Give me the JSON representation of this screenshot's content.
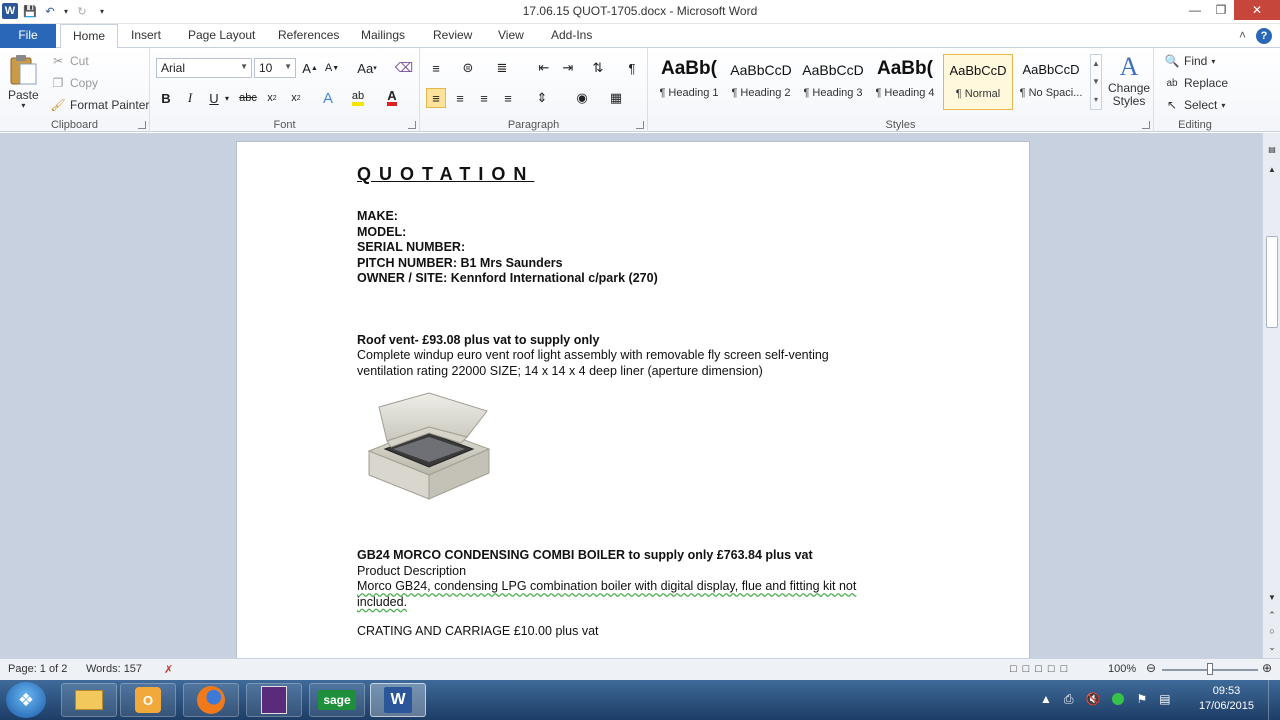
{
  "window": {
    "title": "17.06.15 QUOT-1705.docx - Microsoft Word",
    "app_icon": "word-icon"
  },
  "tabs": [
    {
      "label": "File",
      "key": "file"
    },
    {
      "label": "Home",
      "key": "home",
      "active": true
    },
    {
      "label": "Insert",
      "key": "insert"
    },
    {
      "label": "Page Layout",
      "key": "page-layout"
    },
    {
      "label": "References",
      "key": "references"
    },
    {
      "label": "Mailings",
      "key": "mailings"
    },
    {
      "label": "Review",
      "key": "review"
    },
    {
      "label": "View",
      "key": "view"
    },
    {
      "label": "Add-Ins",
      "key": "add-ins"
    }
  ],
  "ribbon": {
    "clipboard": {
      "label": "Clipboard",
      "paste": "Paste",
      "cut": "Cut",
      "copy": "Copy",
      "format_painter": "Format Painter"
    },
    "font": {
      "label": "Font",
      "font_name": "Arial",
      "font_size": "10"
    },
    "paragraph": {
      "label": "Paragraph"
    },
    "styles": {
      "label": "Styles",
      "items": [
        {
          "sample": "AaBb(",
          "name": "¶ Heading 1"
        },
        {
          "sample": "AaBbCcD",
          "name": "¶ Heading 2"
        },
        {
          "sample": "AaBbCcD",
          "name": "¶ Heading 3"
        },
        {
          "sample": "AaBb(",
          "name": "¶ Heading 4"
        },
        {
          "sample": "AaBbCcD",
          "name": "¶ Normal",
          "selected": true
        },
        {
          "sample": "AaBbCcD",
          "name": "¶ No Spaci..."
        }
      ],
      "change_styles": "Change",
      "change_styles_2": "Styles"
    },
    "editing": {
      "label": "Editing",
      "find": "Find",
      "replace": "Replace",
      "select": "Select"
    }
  },
  "document": {
    "title": "QUOTATION",
    "make": "MAKE:",
    "model": "MODEL:",
    "serial": "SERIAL  NUMBER:",
    "pitch": "PITCH NUMBER: B1 Mrs Saunders",
    "owner": "OWNER / SITE: Kennford  International  c/park (270)",
    "item1_heading": "Roof vent- £93.08 plus vat to supply only",
    "item1_line1": "Complete windup euro vent roof light assembly with removable fly screen self-venting",
    "item1_line2": "ventilation rating 22000  SIZE;  14 x 14 x 4 deep liner (aperture  dimension)",
    "item2_heading": "GB24  MORCO CONDENSING  COMBI BOILER to supply only £763.84  plus vat",
    "item2_sub": "Product Description",
    "item2_line1": "Morco GB24, condensing LPG combination boiler with digital display, flue and fitting kit not",
    "item2_line2": "included.",
    "item3": "CRATING  AND CARRIAGE  £10.00  plus vat"
  },
  "status": {
    "page": "Page: 1 of 2",
    "words": "Words: 157",
    "zoom": "100%",
    "zoom_level": 1.0
  },
  "taskbar": {
    "apps": [
      "windows-explorer",
      "outlook",
      "firefox",
      "calculator",
      "sage",
      "word"
    ],
    "sage_label": "sage",
    "time": "09:53",
    "date": "17/06/2015"
  }
}
